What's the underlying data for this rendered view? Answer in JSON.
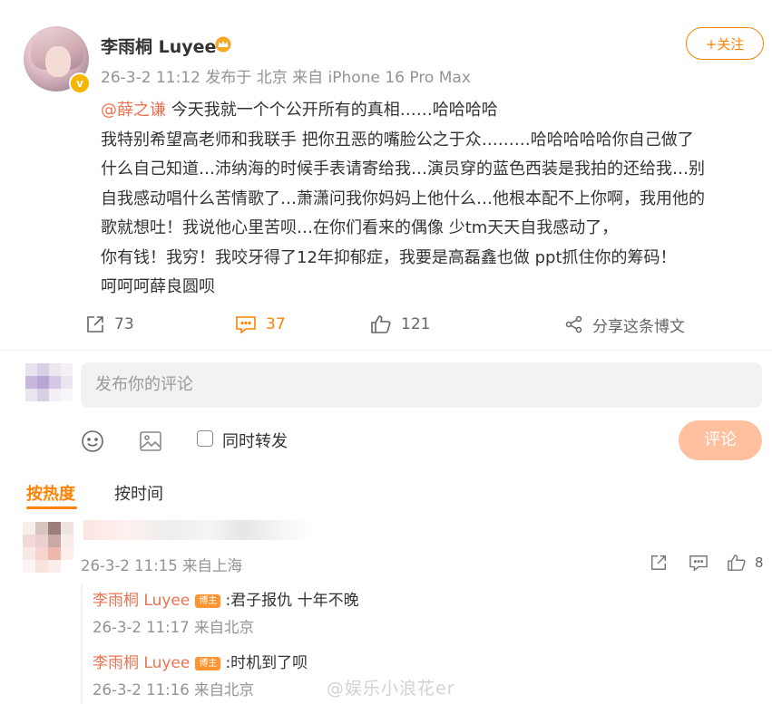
{
  "post": {
    "author": "李雨桐 Luyee",
    "meta": "26-3-2 11:12 发布于 北京 来自 iPhone 16 Pro Max",
    "follow_label": "+关注",
    "mention": "@薛之谦",
    "lines": [
      "今天我就一个个公开所有的真相……哈哈哈哈",
      "我特别希望高老师和我联手 把你丑恶的嘴脸公之于众………哈哈哈哈哈你自己做了",
      "什么自己知道…沛纳海的时候手表请寄给我…演员穿的蓝色西装是我拍的还给我…别",
      "自我感动唱什么苦情歌了…萧潇问我你妈妈上他什么…他根本配不上你啊，我用他的",
      "歌就想吐！我说他心里苦呗…在你们看来的偶像 少tm天天自我感动了，",
      "你有钱！我穷！我咬牙得了12年抑郁症，我要是高磊鑫也做 ppt抓住你的筹码！",
      "呵呵呵薛良圆呗"
    ],
    "actions": {
      "repost": "73",
      "comment": "37",
      "like": "121",
      "share_label": "分享这条博文"
    }
  },
  "comment_box": {
    "placeholder": "发布你的评论",
    "repost_label": "同时转发",
    "submit_label": "评论"
  },
  "sort_tabs": {
    "hot": "按热度",
    "time": "按时间"
  },
  "comments": [
    {
      "time": "26-3-2 11:15 来自上海",
      "likes": "8",
      "replies": [
        {
          "author": "李雨桐 Luyee",
          "badge": "博主",
          "text": ":君子报仇 十年不晚",
          "time": "26-3-2 11:17 来自北京"
        },
        {
          "author": "李雨桐 Luyee",
          "badge": "博主",
          "text": ":时机到了呗",
          "time": "26-3-2 11:16 来自北京"
        }
      ]
    }
  ],
  "watermark": "@娱乐小浪花er",
  "colors": {
    "accent": "#ff8200",
    "mention": "#eb7350",
    "meta_gray": "#939393",
    "submit_disabled": "#ffc09f"
  }
}
